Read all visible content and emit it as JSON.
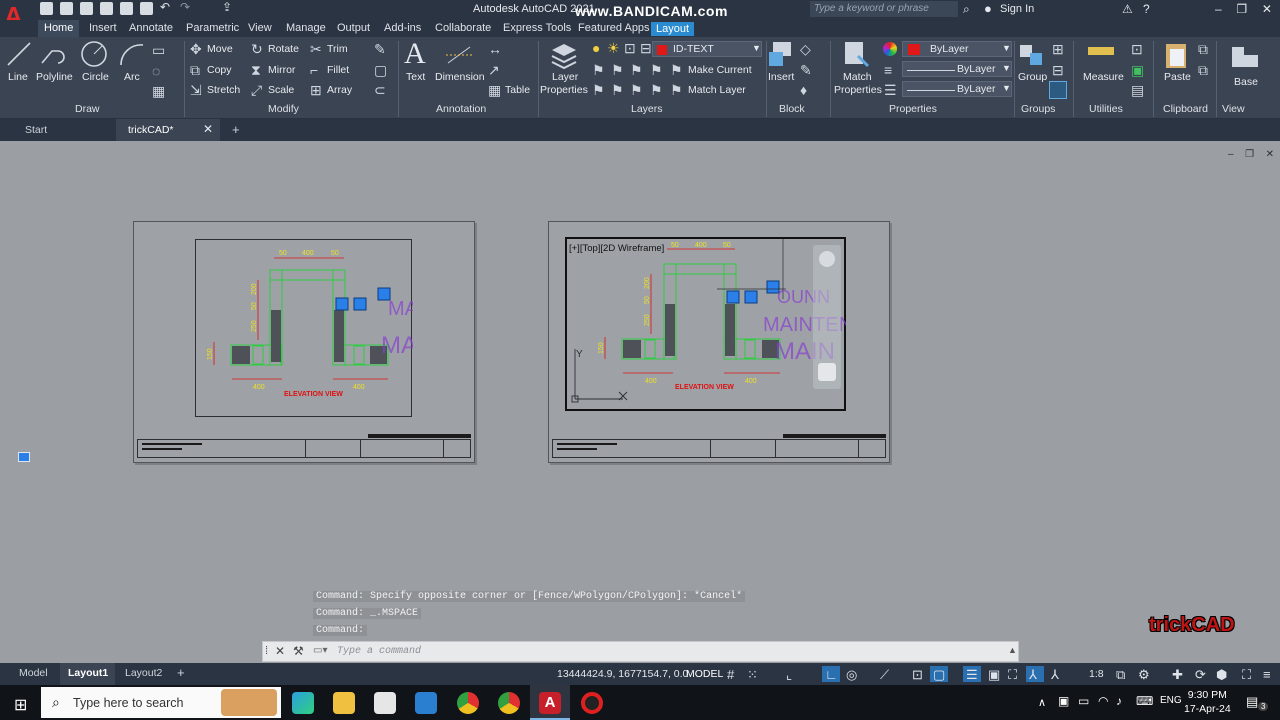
{
  "titlebar": {
    "app_title": "Autodesk AutoCAD 2021",
    "watermark": "www.BANDICAM.com",
    "search_placeholder": "Type a keyword or phrase",
    "sign_in": "Sign In"
  },
  "ribbon_tabs": [
    "Home",
    "Insert",
    "Annotate",
    "Parametric",
    "View",
    "Manage",
    "Output",
    "Add-ins",
    "Collaborate",
    "Express Tools",
    "Featured Apps",
    "Layout"
  ],
  "active_ribbon_tab": "Home",
  "ribbon": {
    "draw": {
      "title": "Draw",
      "line": "Line",
      "polyline": "Polyline",
      "circle": "Circle",
      "arc": "Arc"
    },
    "modify": {
      "title": "Modify",
      "move": "Move",
      "rotate": "Rotate",
      "trim": "Trim",
      "copy": "Copy",
      "mirror": "Mirror",
      "fillet": "Fillet",
      "stretch": "Stretch",
      "scale": "Scale",
      "array": "Array"
    },
    "annotation": {
      "title": "Annotation",
      "text": "Text",
      "dimension": "Dimension",
      "table": "Table"
    },
    "layers": {
      "title": "Layers",
      "layer_properties_1": "Layer",
      "layer_properties_2": "Properties",
      "current_layer": "ID-TEXT",
      "make_current": "Make Current",
      "match_layer": "Match Layer"
    },
    "block": {
      "title": "Block",
      "insert": "Insert"
    },
    "properties": {
      "title": "Properties",
      "match_1": "Match",
      "match_2": "Properties",
      "color": "ByLayer",
      "linetype": "ByLayer",
      "lineweight": "ByLayer"
    },
    "groups": {
      "title": "Groups",
      "group": "Group"
    },
    "utilities": {
      "title": "Utilities",
      "measure": "Measure"
    },
    "clipboard": {
      "title": "Clipboard",
      "paste": "Paste"
    },
    "view": {
      "title": "View",
      "base": "Base"
    }
  },
  "file_tabs": {
    "start": "Start",
    "active": "trickCAD*"
  },
  "drawing": {
    "dims_top": [
      "50",
      "400",
      "50"
    ],
    "dims_left": [
      "200",
      "50",
      "250"
    ],
    "dim_left_bottom": "150",
    "dims_bottom": [
      "400",
      "400"
    ],
    "title": "ELEVATION VIEW",
    "viewport_label": "[+][Top][2D Wireframe]",
    "purple_text_1": "MAINTEN",
    "purple_text_2": "MAIN",
    "purple_text_3": "OUNN"
  },
  "command": {
    "history": [
      "Command: Specify opposite corner or [Fence/WPolygon/CPolygon]: *Cancel*",
      "Command: _.MSPACE",
      "Command:"
    ],
    "placeholder": "Type a command"
  },
  "statusbar": {
    "tabs": [
      "Model",
      "Layout1",
      "Layout2"
    ],
    "active_tab": "Layout1",
    "coords": "13444424.9, 1677154.7, 0.0",
    "mode": "MODEL",
    "scale": "1:8"
  },
  "taskbar": {
    "search": "Type here to search",
    "time": "9:30 PM",
    "date": "17-Apr-24",
    "notifications": "3"
  },
  "brand_watermark": "trickCAD",
  "colors": {
    "ribbon_bg": "#3b4453",
    "titlebar_bg": "#2b3442",
    "canvas_bg": "#9b9fa4",
    "accent_blue": "#2a8bd0",
    "wall_green": "#2ecc40",
    "dim_red": "#e01010",
    "dim_yellow": "#f0e020",
    "purple": "#8a3fd0"
  }
}
